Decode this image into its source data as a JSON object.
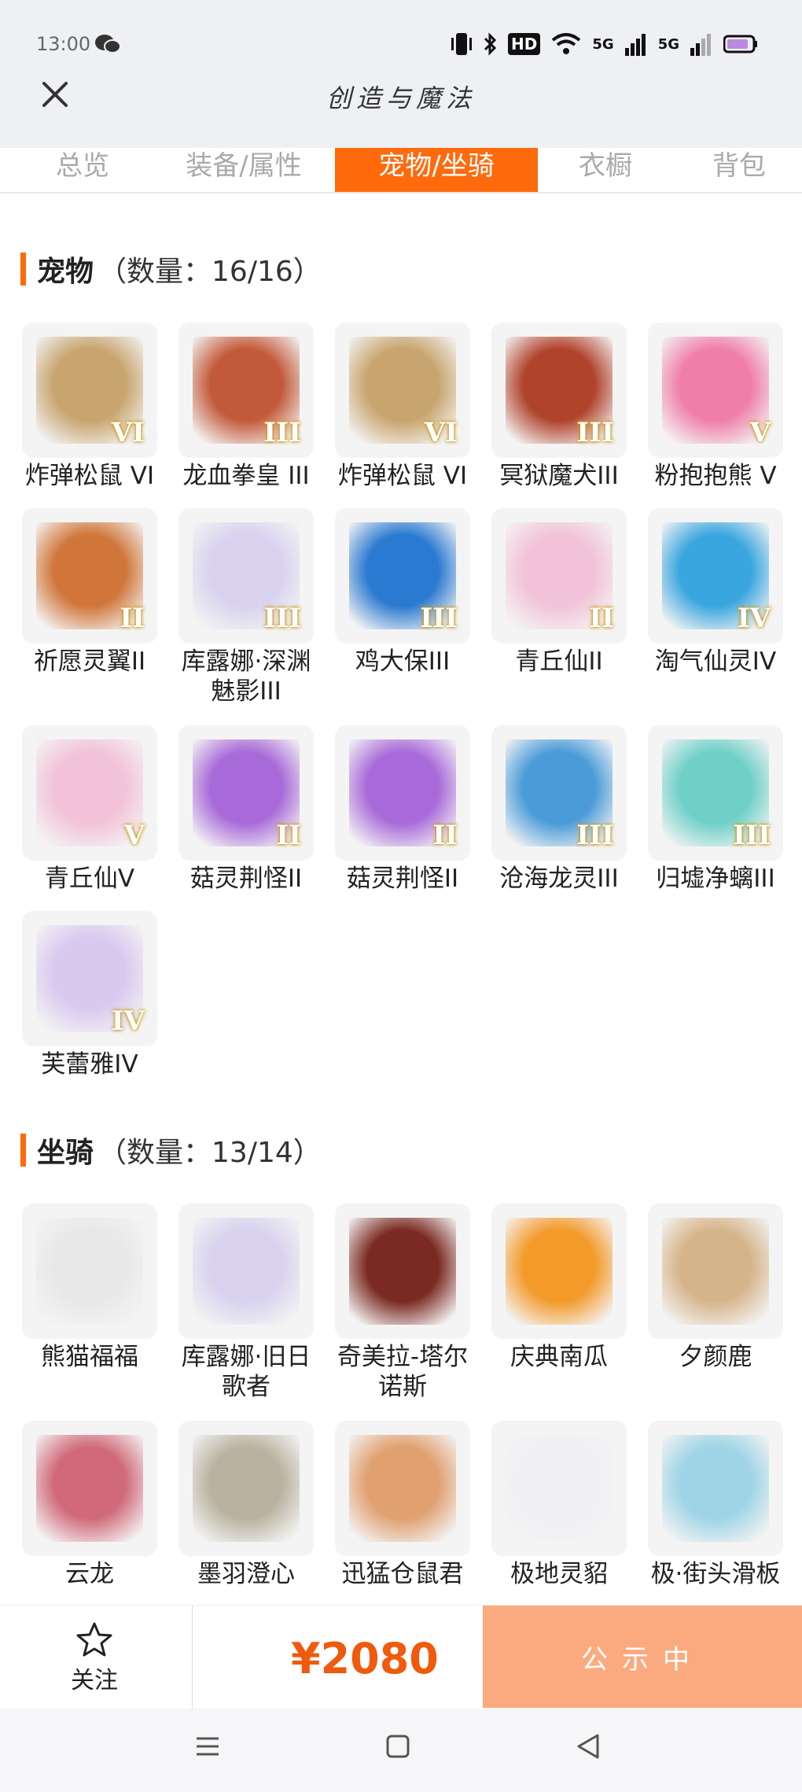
{
  "status_bar": {
    "time": "13:00",
    "network_labels": [
      "HD",
      "5G",
      "5G"
    ]
  },
  "header": {
    "title": "创造与魔法"
  },
  "tabs": [
    {
      "label": "总览"
    },
    {
      "label": "装备/属性"
    },
    {
      "label": "宠物/坐骑",
      "active": true
    },
    {
      "label": "衣橱"
    },
    {
      "label": "背包"
    }
  ],
  "pets": {
    "name": "宠物",
    "count": "（数量：16/16）",
    "items": [
      {
        "label": "炸弹松鼠 VI",
        "tier": "VI",
        "color": "#c8a46e"
      },
      {
        "label": "龙血拳皇 III",
        "tier": "III",
        "color": "#c25a3a"
      },
      {
        "label": "炸弹松鼠 VI",
        "tier": "VI",
        "color": "#c8a46e"
      },
      {
        "label": "冥狱魔犬III",
        "tier": "III",
        "color": "#b0432c"
      },
      {
        "label": "粉抱抱熊 V",
        "tier": "V",
        "color": "#ef7fa8"
      },
      {
        "label": "祈愿灵翼II",
        "tier": "II",
        "color": "#d0763a"
      },
      {
        "label": "库露娜·深渊魅影III",
        "tier": "III",
        "color": "#d8d2ee"
      },
      {
        "label": "鸡大保III",
        "tier": "III",
        "color": "#2b7ad1"
      },
      {
        "label": "青丘仙II",
        "tier": "II",
        "color": "#f2c3d8"
      },
      {
        "label": "淘气仙灵IV",
        "tier": "IV",
        "color": "#3aa6df"
      },
      {
        "label": "青丘仙V",
        "tier": "V",
        "color": "#f2c3d8"
      },
      {
        "label": "菇灵荆怪II",
        "tier": "II",
        "color": "#a86ad8"
      },
      {
        "label": "菇灵荆怪II",
        "tier": "II",
        "color": "#a86ad8"
      },
      {
        "label": "沧海龙灵III",
        "tier": "III",
        "color": "#4a9bd8"
      },
      {
        "label": "归墟净螭III",
        "tier": "III",
        "color": "#6fd0c8"
      },
      {
        "label": "芙蕾雅IV",
        "tier": "IV",
        "color": "#d9c9ef"
      }
    ]
  },
  "mounts": {
    "name": "坐骑",
    "count": "（数量：13/14）",
    "items": [
      {
        "label": "熊猫福福",
        "color": "#e8e8e8"
      },
      {
        "label": "库露娜·旧日歌者",
        "color": "#d8d2ee"
      },
      {
        "label": "奇美拉-塔尔诺斯",
        "color": "#7a2a22"
      },
      {
        "label": "庆典南瓜",
        "color": "#f39a2a"
      },
      {
        "label": "夕颜鹿",
        "color": "#d6b48a"
      },
      {
        "label": "云龙",
        "color": "#d06a7a"
      },
      {
        "label": "墨羽澄心",
        "color": "#b9b2a0"
      },
      {
        "label": "迅猛仓鼠君",
        "color": "#e0a070"
      },
      {
        "label": "极地灵貂",
        "color": "#f0f0f4"
      },
      {
        "label": "极·街头滑板",
        "color": "#9fd4e6"
      }
    ]
  },
  "bottom_bar": {
    "follow_label": "关注",
    "price": "¥2080",
    "buy_label": "公示中"
  },
  "colors": {
    "accent": "#ff6a0d",
    "price": "#f05a0c",
    "buy_bg": "#fbaa80"
  }
}
